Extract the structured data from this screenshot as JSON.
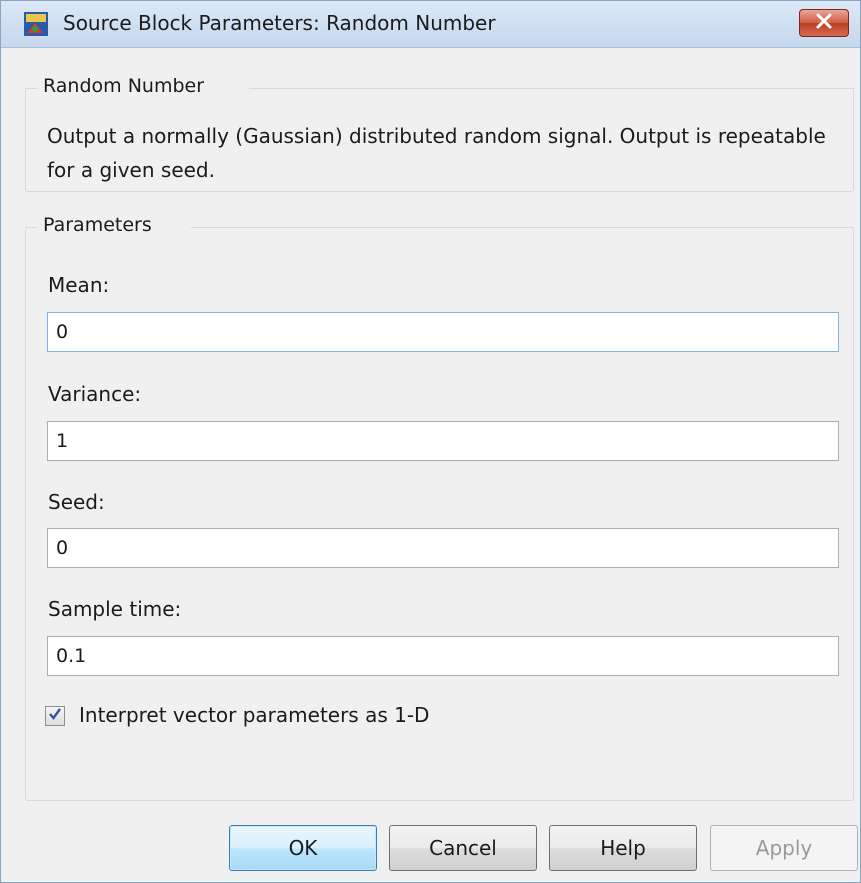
{
  "window": {
    "title": "Source Block Parameters: Random Number"
  },
  "description": {
    "legend": "Random Number",
    "text": "Output a normally (Gaussian) distributed random signal.  Output is repeatable for a given seed."
  },
  "parameters": {
    "legend": "Parameters",
    "fields": [
      {
        "label": "Mean:",
        "value": "0"
      },
      {
        "label": "Variance:",
        "value": "1"
      },
      {
        "label": "Seed:",
        "value": "0"
      },
      {
        "label": "Sample time:",
        "value": "0.1"
      }
    ],
    "checkbox": {
      "label": "Interpret vector parameters as 1-D",
      "checked": true
    }
  },
  "buttons": {
    "ok": "OK",
    "cancel": "Cancel",
    "help": "Help",
    "apply": "Apply"
  },
  "colors": {
    "titlebar": "#c6d8ee",
    "close_button": "#c94a32",
    "focus_border": "#7eb4ea"
  }
}
